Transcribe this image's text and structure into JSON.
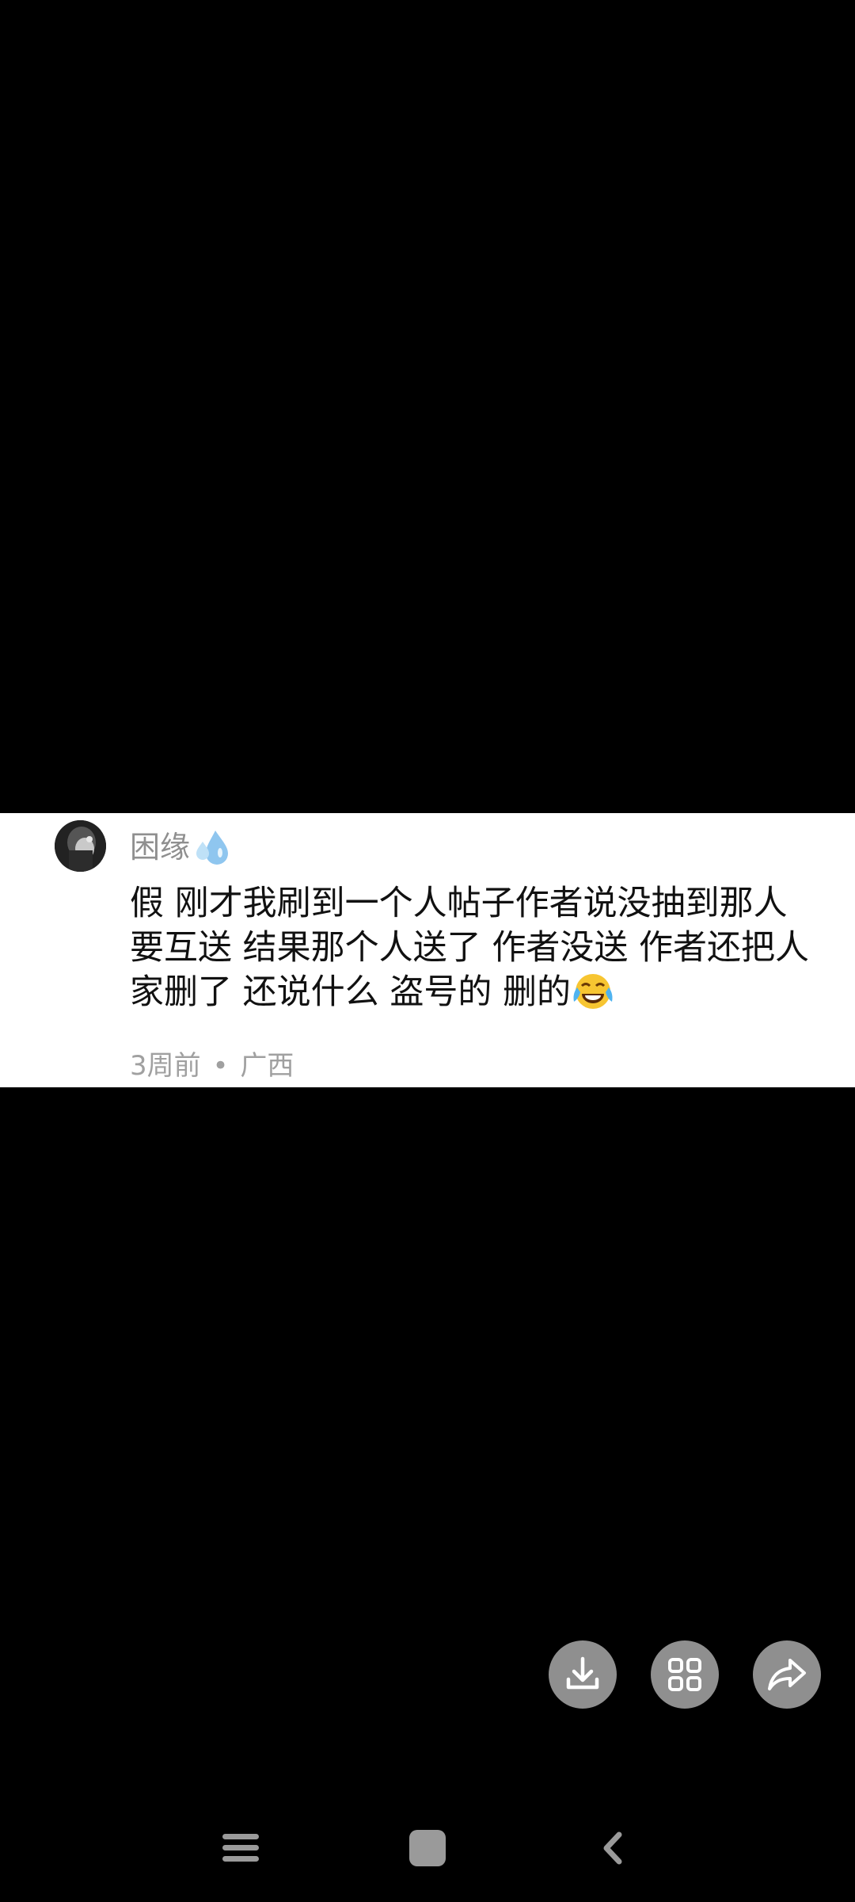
{
  "comment": {
    "username": "困缘",
    "username_emoji": "sweat-droplets",
    "text": "假 刚才我刷到一个人帖子作者说没抽到那人 要互送 结果那个人送了  作者没送  作者还把人家删了 还说什么 盗号的 删的",
    "text_emoji": "face-with-tears-of-joy",
    "time": "3周前",
    "separator": "•",
    "location": "广西"
  },
  "actions": {
    "download": "download-icon",
    "grid": "grid-icon",
    "share": "share-icon"
  },
  "system_nav": {
    "menu": "menu-icon",
    "home": "home-icon",
    "back": "back-icon"
  },
  "colors": {
    "background": "#000000",
    "card": "#ffffff",
    "muted_text": "#8f8f8f",
    "action_button": "#8f8f8f",
    "nav_icon": "#9a9a9a"
  }
}
